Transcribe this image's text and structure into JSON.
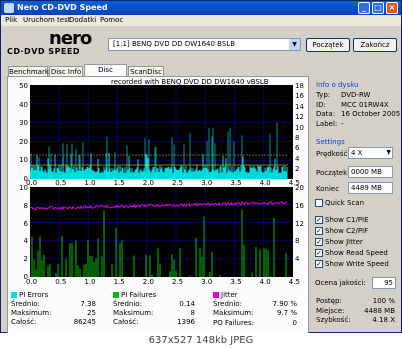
{
  "window": {
    "title": "Nero CD-DVD Speed"
  },
  "menu": [
    "Plik",
    "Uruchom test",
    "Dodatki",
    "Pomoc"
  ],
  "logo": {
    "brand": "nero",
    "product": "CD·DVD SPEED"
  },
  "drive_select": "[1:1]  BENQ DVD DD DW1640 BSLB",
  "buttons": {
    "start": "Początek",
    "close": "Zakończ"
  },
  "tabs": [
    "Benchmark",
    "Disc Info",
    "Disc Quality",
    "ScanDisc"
  ],
  "active_tab": "Disc Quality",
  "chart_top": {
    "caption": "recorded with BENQ     DVD DD DW1640     vBSLB",
    "left_ticks": [
      "50",
      "40",
      "30",
      "20",
      "10",
      "0"
    ],
    "right_ticks": [
      "18",
      "16",
      "14",
      "12",
      "10",
      "8",
      "6",
      "4",
      "2"
    ],
    "x_ticks": [
      "0.0",
      "0.5",
      "1.0",
      "1.5",
      "2.0",
      "2.5",
      "3.0",
      "3.5",
      "4.0",
      "4.5"
    ]
  },
  "chart_bottom": {
    "left_ticks": [
      "10",
      "8",
      "6",
      "4",
      "2",
      "0"
    ],
    "right_ticks": [
      "20",
      "16",
      "12",
      "8",
      "4"
    ],
    "x_ticks": [
      "0.0",
      "0.5",
      "1.0",
      "1.5",
      "2.0",
      "2.5",
      "3.0",
      "3.5",
      "4.0",
      "4.5"
    ]
  },
  "disc_info": {
    "title": "Info o dysku",
    "rows": [
      {
        "k": "Typ:",
        "v": "DVD-RW"
      },
      {
        "k": "ID:",
        "v": "MCC 01RW4X"
      },
      {
        "k": "Data:",
        "v": "16 October 2005"
      },
      {
        "k": "Label:",
        "v": "-"
      }
    ]
  },
  "settings": {
    "title": "Settings",
    "speed_label": "Prędkość",
    "speed_value": "4 X",
    "start_label": "Początek",
    "start_value": "0000 MB",
    "end_label": "Koniec",
    "end_value": "4489 MB",
    "quick_scan": "Quick Scan"
  },
  "checkboxes": [
    "Show C1/PIE",
    "Show C2/PIF",
    "Show Jitter",
    "Show Read Speed",
    "Show Write Speed"
  ],
  "quality": {
    "label": "Ocena jakości:",
    "value": "95"
  },
  "pi_errors": {
    "title": "PI Errors",
    "color": "#00e0e0",
    "rows": [
      {
        "k": "Średnio:",
        "v": "7.38"
      },
      {
        "k": "Maksimum:",
        "v": "25"
      },
      {
        "k": "Całość:",
        "v": "86245"
      }
    ]
  },
  "pi_failures": {
    "title": "PI Failures",
    "color": "#00c000",
    "rows": [
      {
        "k": "Średnio:",
        "v": "0.14"
      },
      {
        "k": "Maksimum:",
        "v": "8"
      },
      {
        "k": "Całość:",
        "v": "1396"
      }
    ]
  },
  "jitter": {
    "title": "Jitter",
    "color": "#e000e0",
    "rows": [
      {
        "k": "Średnio:",
        "v": "7.90 %"
      },
      {
        "k": "Maksimum:",
        "v": "9.7 %"
      }
    ],
    "po_label": "PO Failures:",
    "po_value": "0"
  },
  "progress": {
    "rows": [
      {
        "k": "Postęp:",
        "v": "100 %"
      },
      {
        "k": "Miejsce:",
        "v": "4488 MB"
      },
      {
        "k": "Szybkość:",
        "v": "4.18 X"
      }
    ]
  },
  "status_bar": "637x527  148kb  JPEG"
}
